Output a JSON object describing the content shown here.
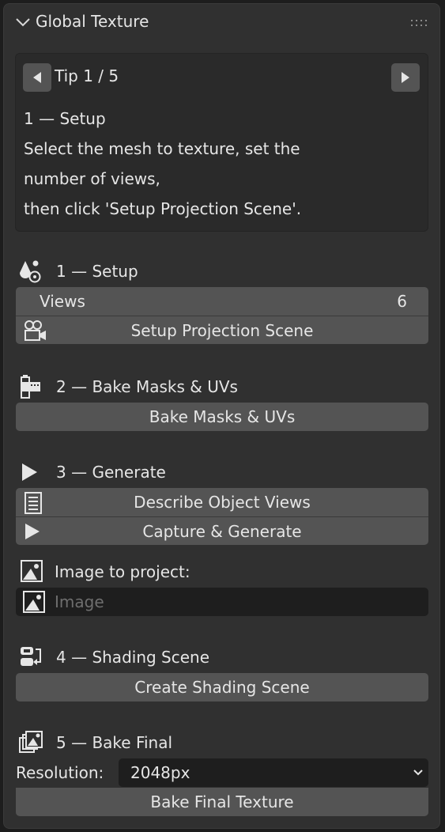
{
  "panel": {
    "title": "Global Texture",
    "icons": {
      "collapse": "chevron-down-icon",
      "grip": "drag-grip-icon"
    }
  },
  "tip": {
    "counter": "Tip 1 / 5",
    "lines": [
      "1 — Setup",
      "Select the mesh to texture, set the",
      "number of views,",
      "then click 'Setup Projection Scene'."
    ]
  },
  "section1": {
    "title": "1 — Setup",
    "views_label": "Views",
    "views_value": "6",
    "setup_button": "Setup Projection Scene"
  },
  "section2": {
    "title": "2 — Bake Masks & UVs",
    "bake_button": "Bake Masks & UVs"
  },
  "section3": {
    "title": "3 — Generate",
    "describe_button": "Describe Object Views",
    "capture_button": "Capture & Generate",
    "image_label": "Image to project:",
    "image_placeholder": "Image"
  },
  "section4": {
    "title": "4 — Shading Scene",
    "create_button": "Create Shading Scene"
  },
  "section5": {
    "title": "5 — Bake Final",
    "resolution_label": "Resolution:",
    "resolution_value": "2048px",
    "bake_button": "Bake Final Texture"
  },
  "colors": {
    "panel": "#303030",
    "button": "#545454",
    "field": "#1e1e1e",
    "text": "#e6e6e6"
  }
}
